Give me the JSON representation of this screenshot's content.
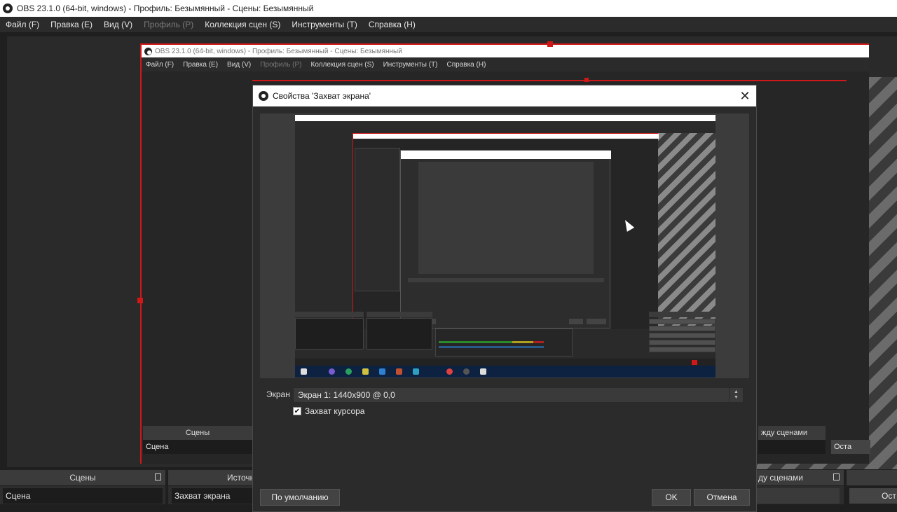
{
  "window": {
    "title": "OBS 23.1.0 (64-bit, windows) - Профиль: Безымянный - Сцены: Безымянный"
  },
  "menu": {
    "file": "Файл (F)",
    "edit": "Правка (E)",
    "view": "Вид (V)",
    "profile": "Профиль (P)",
    "scene_collection": "Коллекция сцен (S)",
    "tools": "Инструменты (T)",
    "help": "Справка (H)"
  },
  "docks": {
    "scenes_header": "Сцены",
    "scene_item": "Сцена",
    "sources_header": "Источн",
    "source_item": "Захват экрана",
    "transitions_header": "ду сценами",
    "transitions_header_nested": "жду сценами",
    "controls_button": "Ост",
    "controls_button_nested": "Оста"
  },
  "dialog": {
    "title": "Свойства 'Захват экрана'",
    "close_glyph": "✕",
    "screen_label": "Экран",
    "screen_value": "Экран 1: 1440x900 @ 0,0",
    "capture_cursor_label": "Захват курсора",
    "capture_cursor_checked": true,
    "defaults_button": "По умолчанию",
    "ok_button": "OK",
    "cancel_button": "Отмена"
  },
  "icons": {
    "app": "obs-logo-icon",
    "close": "close-icon",
    "pin": "pin-icon",
    "spin_up": "chevron-up-icon",
    "spin_down": "chevron-down-icon",
    "check": "checkmark-icon"
  },
  "colors": {
    "accent_red": "#d01818",
    "dark_bg": "#2b2b2b",
    "taskbar": "#0c2240"
  }
}
